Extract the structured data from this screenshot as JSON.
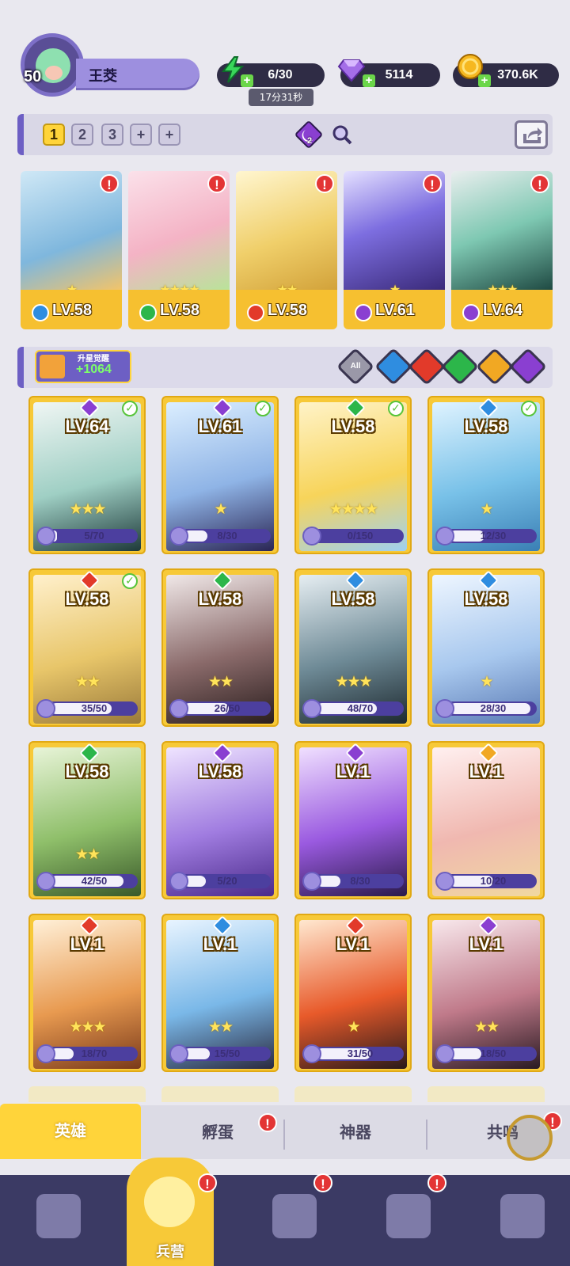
{
  "player": {
    "level": "50",
    "name": "王茭"
  },
  "resources": {
    "energy": "6/30",
    "energy_timer": "17分31秒",
    "gems": "5114",
    "gold": "370.6K"
  },
  "team_tabs": [
    "1",
    "2",
    "3",
    "+",
    "+"
  ],
  "team_badge_count": "2",
  "team_heroes": [
    {
      "level": "LV.58",
      "stars": 1,
      "element": "water"
    },
    {
      "level": "LV.58",
      "stars": 4,
      "element": "wind"
    },
    {
      "level": "LV.58",
      "stars": 2,
      "element": "fire"
    },
    {
      "level": "LV.61",
      "stars": 1,
      "element": "dark"
    },
    {
      "level": "LV.64",
      "stars": 3,
      "element": "dark"
    }
  ],
  "awaken": {
    "label": "升星觉醒",
    "value": "+1064"
  },
  "filters": {
    "all_label": "All"
  },
  "heroes": [
    {
      "level": "LV.64",
      "shards": "5/70",
      "progress": 0.07,
      "stars": 3,
      "element": "dark",
      "ready": true
    },
    {
      "level": "LV.61",
      "shards": "8/30",
      "progress": 0.27,
      "stars": 1,
      "element": "dark",
      "ready": true
    },
    {
      "level": "LV.58",
      "shards": "0/150",
      "progress": 0.0,
      "stars": 4,
      "element": "wind",
      "ready": true
    },
    {
      "level": "LV.58",
      "shards": "12/30",
      "progress": 0.4,
      "stars": 1,
      "element": "water",
      "ready": true
    },
    {
      "level": "LV.58",
      "shards": "35/50",
      "progress": 0.7,
      "stars": 2,
      "element": "fire",
      "ready": true
    },
    {
      "level": "LV.58",
      "shards": "26/50",
      "progress": 0.52,
      "stars": 2,
      "element": "wind",
      "ready": false
    },
    {
      "level": "LV.58",
      "shards": "48/70",
      "progress": 0.69,
      "stars": 3,
      "element": "water",
      "ready": false
    },
    {
      "level": "LV.58",
      "shards": "28/30",
      "progress": 0.93,
      "stars": 1,
      "element": "water",
      "ready": false
    },
    {
      "level": "LV.58",
      "shards": "42/50",
      "progress": 0.84,
      "stars": 2,
      "element": "wind",
      "ready": false
    },
    {
      "level": "LV.58",
      "shards": "5/20",
      "progress": 0.25,
      "stars": 0,
      "element": "dark",
      "ready": false
    },
    {
      "level": "LV.1",
      "shards": "8/30",
      "progress": 0.27,
      "stars": 0,
      "element": "dark",
      "ready": false
    },
    {
      "level": "LV.1",
      "shards": "10/20",
      "progress": 0.5,
      "stars": 0,
      "element": "light",
      "ready": false
    },
    {
      "level": "LV.1",
      "shards": "18/70",
      "progress": 0.26,
      "stars": 3,
      "element": "fire",
      "ready": false
    },
    {
      "level": "LV.1",
      "shards": "15/50",
      "progress": 0.3,
      "stars": 2,
      "element": "water",
      "ready": false
    },
    {
      "level": "LV.1",
      "shards": "31/50",
      "progress": 0.62,
      "stars": 1,
      "element": "fire",
      "ready": false
    },
    {
      "level": "LV.1",
      "shards": "18/50",
      "progress": 0.36,
      "stars": 2,
      "element": "dark",
      "ready": false
    }
  ],
  "sub_tabs": {
    "heroes": "英雄",
    "hatch": "孵蛋",
    "artifact": "神器",
    "resonance": "共鸣"
  },
  "nav": {
    "barracks": "兵营"
  },
  "colors": {
    "gold": "#f7c938",
    "purple": "#6d5fc4",
    "navbar": "#3b3a64",
    "water": "#2f8de0",
    "fire": "#e23a2a",
    "wind": "#2cb64a",
    "light": "#f1a823",
    "dark": "#8a3fd1",
    "alert": "#e33535"
  }
}
